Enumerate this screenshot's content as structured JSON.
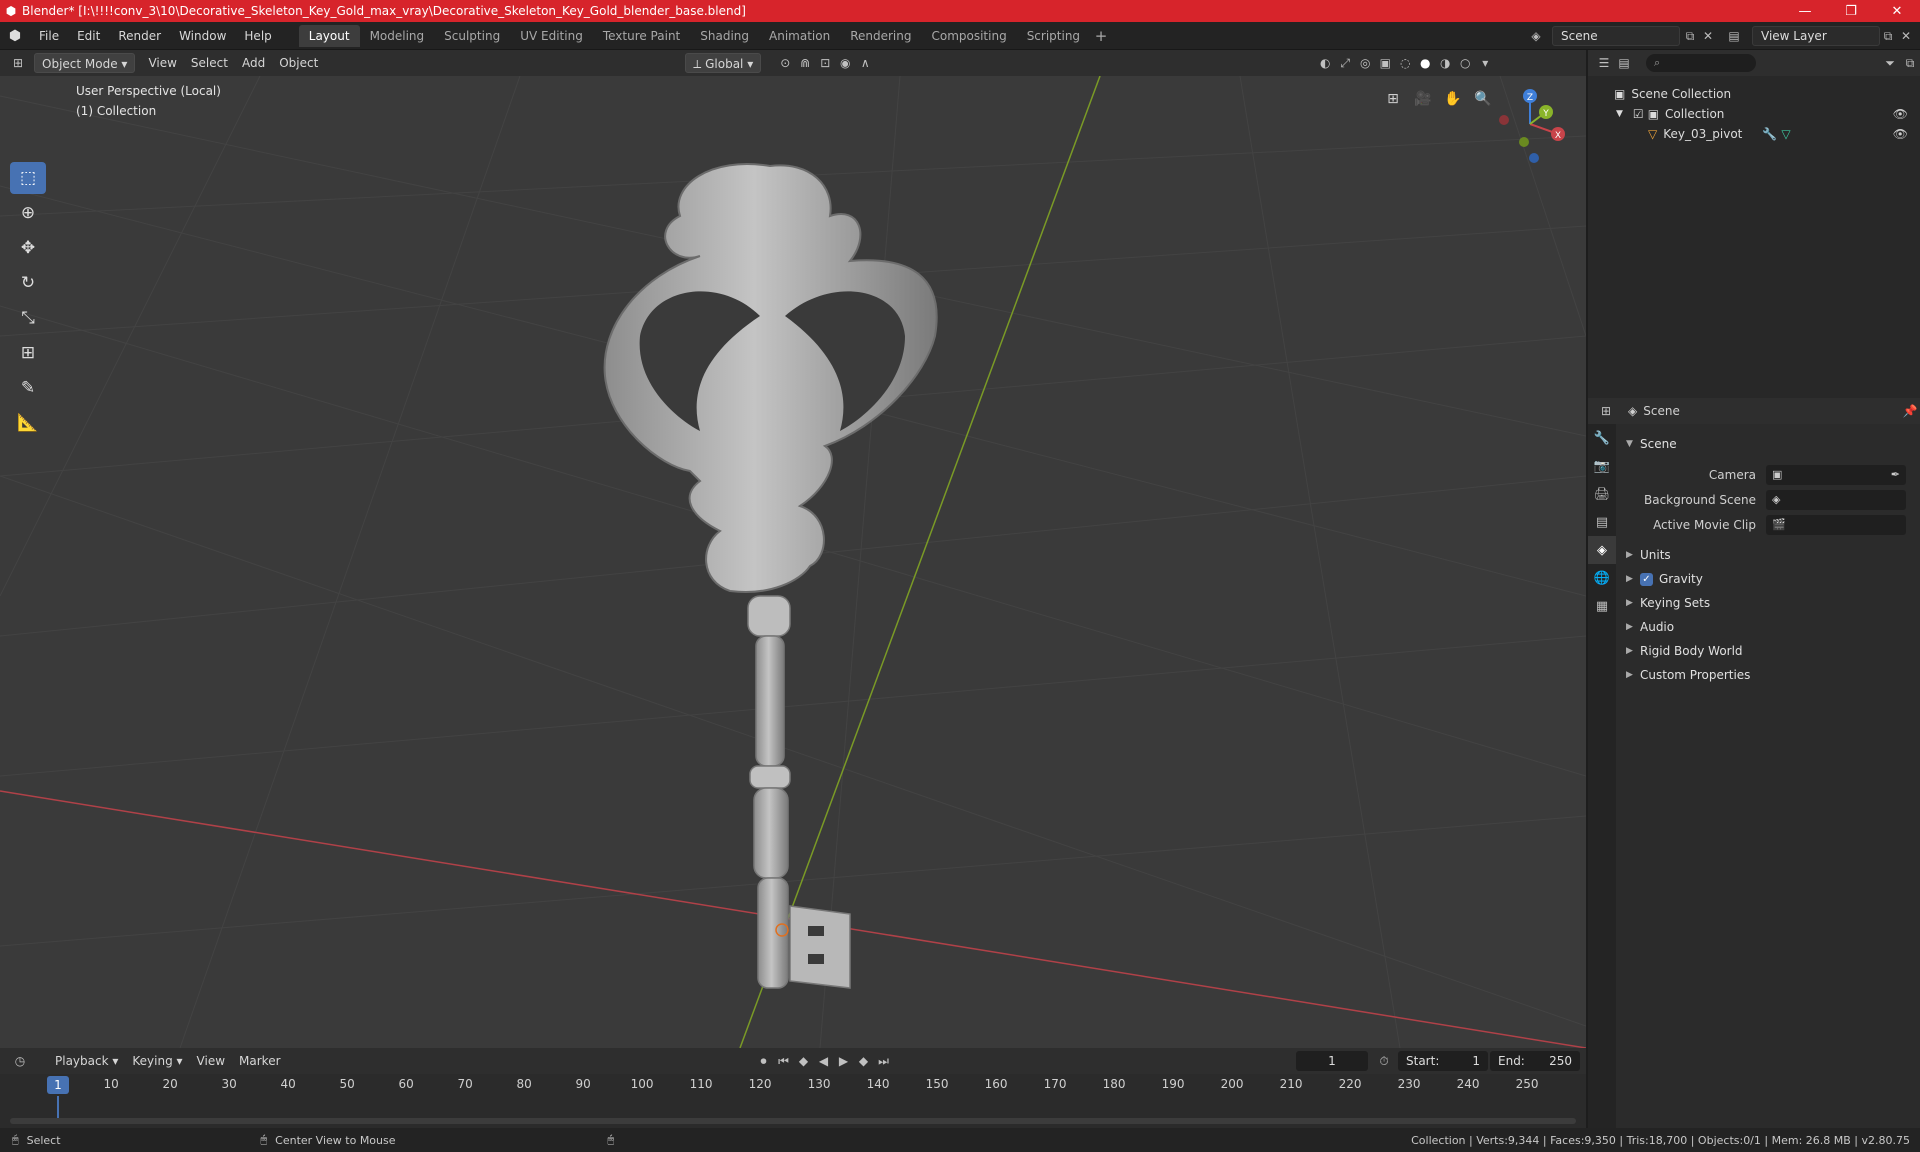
{
  "window": {
    "title": "Blender* [I:\\!!!!conv_3\\10\\Decorative_Skeleton_Key_Gold_max_vray\\Decorative_Skeleton_Key_Gold_blender_base.blend]",
    "minimize": "—",
    "maximize": "❐",
    "close": "✕"
  },
  "menu": [
    "File",
    "Edit",
    "Render",
    "Window",
    "Help"
  ],
  "workspaces": [
    "Layout",
    "Modeling",
    "Sculpting",
    "UV Editing",
    "Texture Paint",
    "Shading",
    "Animation",
    "Rendering",
    "Compositing",
    "Scripting"
  ],
  "active_workspace": "Layout",
  "scene_name": "Scene",
  "view_layer": "View Layer",
  "viewport_header": {
    "mode": "Object Mode",
    "menus": [
      "View",
      "Select",
      "Add",
      "Object"
    ],
    "orientation": "Global"
  },
  "viewport": {
    "perspective_label": "User Perspective (Local)",
    "collection_label": "(1) Collection",
    "gizmo_axes": {
      "x": "X",
      "y": "Y",
      "z": "Z"
    }
  },
  "outliner": {
    "root": "Scene Collection",
    "collection": "Collection",
    "object": "Key_03_pivot"
  },
  "properties": {
    "context": "Scene",
    "panel": "Scene",
    "fields": [
      {
        "label": "Camera"
      },
      {
        "label": "Background Scene"
      },
      {
        "label": "Active Movie Clip"
      }
    ],
    "sections": [
      "Units",
      "Gravity",
      "Keying Sets",
      "Audio",
      "Rigid Body World",
      "Custom Properties"
    ]
  },
  "timeline": {
    "menus": [
      "Playback",
      "Keying",
      "View",
      "Marker"
    ],
    "current_frame": "1",
    "start_label": "Start:",
    "start": "1",
    "end_label": "End:",
    "end": "250",
    "ticks": [
      "1",
      "10",
      "20",
      "30",
      "40",
      "50",
      "60",
      "70",
      "80",
      "90",
      "100",
      "110",
      "120",
      "130",
      "140",
      "150",
      "160",
      "170",
      "180",
      "190",
      "200",
      "210",
      "220",
      "230",
      "240",
      "250"
    ]
  },
  "statusbar": {
    "select": "Select",
    "center": "Center View to Mouse",
    "stats": "Collection | Verts:9,344 | Faces:9,350 | Tris:18,700 | Objects:0/1 | Mem: 26.8 MB | v2.80.75"
  },
  "colors": {
    "title_bar": "#d7242b",
    "accent": "#4772b3",
    "x_axis": "#c8444a",
    "y_axis": "#8ab42a",
    "z_axis": "#3f7fd9"
  }
}
